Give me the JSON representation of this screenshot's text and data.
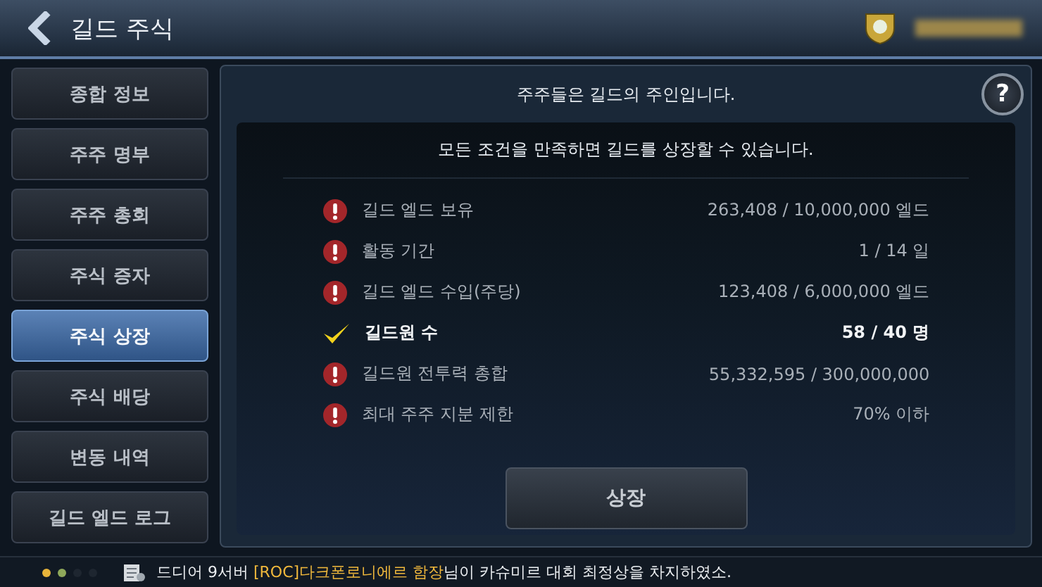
{
  "header": {
    "title": "길드 주식"
  },
  "sidebar": {
    "items": [
      {
        "label": "종합 정보",
        "selected": false
      },
      {
        "label": "주주 명부",
        "selected": false
      },
      {
        "label": "주주 총회",
        "selected": false
      },
      {
        "label": "주식 증자",
        "selected": false
      },
      {
        "label": "주식 상장",
        "selected": true
      },
      {
        "label": "주식 배당",
        "selected": false
      },
      {
        "label": "변동 내역",
        "selected": false
      },
      {
        "label": "길드 엘드 로그",
        "selected": false
      }
    ]
  },
  "panel": {
    "title": "주주들은 길드의 주인입니다.",
    "help": "?",
    "subtitle": "모든 조건을 만족하면 길드를 상장할 수 있습니다.",
    "conditions": [
      {
        "kind": "unmet",
        "label": "길드 엘드 보유",
        "value": "263,408 / 10,000,000 엘드"
      },
      {
        "kind": "unmet",
        "label": "활동 기간",
        "value": "1 / 14 일"
      },
      {
        "kind": "unmet",
        "label": "길드 엘드 수입(주당)",
        "value": "123,408 / 6,000,000 엘드"
      },
      {
        "kind": "met",
        "label": "길드원 수",
        "value": "58 / 40 명"
      },
      {
        "kind": "unmet",
        "label": "길드원 전투력 총합",
        "value": "55,332,595 / 300,000,000"
      },
      {
        "kind": "unmet",
        "label": "최대 주주 지분 제한",
        "value": "70% 이하"
      }
    ],
    "button": "상장"
  },
  "ticker": {
    "dots": [
      {
        "color": "#e8b43a"
      },
      {
        "color": "#8fa85a"
      },
      {
        "color": "#1e2630"
      },
      {
        "color": "#1e2630"
      }
    ],
    "parts": [
      {
        "text": "드디어 9서버 ",
        "highlight": false
      },
      {
        "text": "[ROC]다크폰로니에르 함장",
        "highlight": true
      },
      {
        "text": "님이 카슈미르 대회 최정상을 차지하였소.",
        "highlight": false
      }
    ]
  }
}
